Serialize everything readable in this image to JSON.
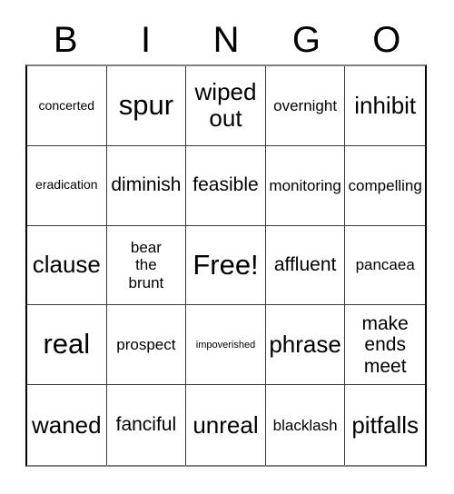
{
  "card": {
    "header": {
      "letters": [
        "B",
        "I",
        "N",
        "G",
        "O"
      ]
    },
    "colors": {
      "background": "#ffffff",
      "text": "#000000",
      "grid_line": "#3a3a3a",
      "outer_border": "#000000"
    },
    "grid": {
      "columns": 5,
      "rows": 5,
      "cells": [
        {
          "text": "concerted",
          "size": "fs-s"
        },
        {
          "text": "spur",
          "size": "fs-xxl"
        },
        {
          "text": "wiped\nout",
          "size": "fs-xl"
        },
        {
          "text": "overnight",
          "size": "fs-m"
        },
        {
          "text": "inhibit",
          "size": "fs-xl"
        },
        {
          "text": "eradication",
          "size": "fs-s"
        },
        {
          "text": "diminish",
          "size": "fs-l"
        },
        {
          "text": "feasible",
          "size": "fs-l"
        },
        {
          "text": "monitoring",
          "size": "fs-m"
        },
        {
          "text": "compelling",
          "size": "fs-m"
        },
        {
          "text": "clause",
          "size": "fs-xl"
        },
        {
          "text": "bear\nthe\nbrunt",
          "size": "fs-m"
        },
        {
          "text": "Free!",
          "size": "fs-xxl"
        },
        {
          "text": "affluent",
          "size": "fs-l"
        },
        {
          "text": "pancaea",
          "size": "fs-m"
        },
        {
          "text": "real",
          "size": "fs-xxl"
        },
        {
          "text": "prospect",
          "size": "fs-m"
        },
        {
          "text": "impoverished",
          "size": "fs-xs"
        },
        {
          "text": "phrase",
          "size": "fs-xl"
        },
        {
          "text": "make\nends\nmeet",
          "size": "fs-l"
        },
        {
          "text": "waned",
          "size": "fs-xl"
        },
        {
          "text": "fanciful",
          "size": "fs-l"
        },
        {
          "text": "unreal",
          "size": "fs-xl"
        },
        {
          "text": "blacklash",
          "size": "fs-m"
        },
        {
          "text": "pitfalls",
          "size": "fs-xl"
        }
      ]
    }
  }
}
